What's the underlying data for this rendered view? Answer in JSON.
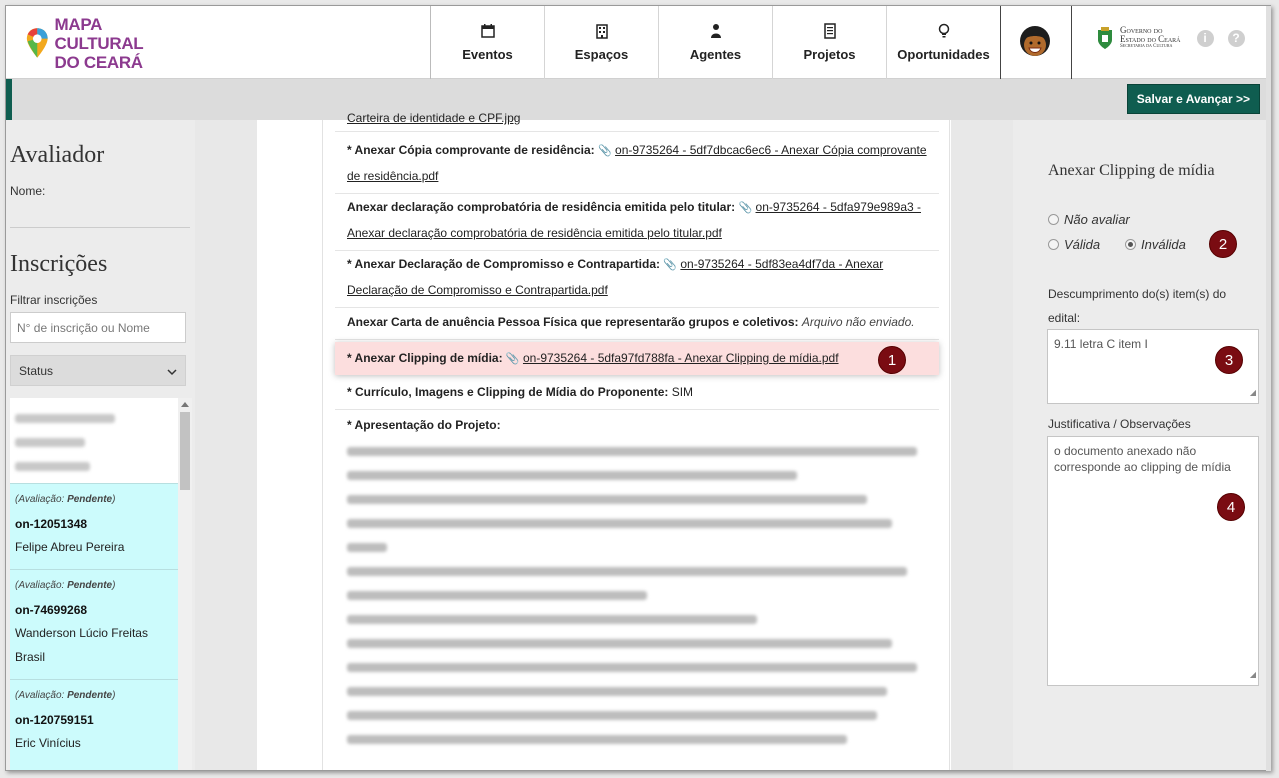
{
  "header": {
    "logo_line1": "MAPA CULTURAL",
    "logo_line2": "DO CEARÁ",
    "nav": [
      {
        "label": "Eventos",
        "icon": "calendar-icon",
        "glyph": "▭"
      },
      {
        "label": "Espaços",
        "icon": "building-icon",
        "glyph": "▥"
      },
      {
        "label": "Agentes",
        "icon": "person-icon",
        "glyph": "●"
      },
      {
        "label": "Projetos",
        "icon": "document-icon",
        "glyph": "▤"
      },
      {
        "label": "Oportunidades",
        "icon": "lightbulb-icon",
        "glyph": "♀"
      }
    ],
    "gov_line1": "Governo do",
    "gov_line2": "Estado do Ceará",
    "gov_line3": "Secretaria da Cultura",
    "info_glyph": "i",
    "help_glyph": "?"
  },
  "toolbar": {
    "save_label": "Salvar e Avançar >>"
  },
  "left": {
    "title": "Avaliador",
    "name_label": "Nome:",
    "inscricoes_title": "Inscrições",
    "filter_label": "Filtrar inscrições",
    "filter_placeholder": "N° de inscrição ou Nome",
    "status_label": "Status",
    "cards": [
      {
        "eval_prefix": "(Avaliação: ",
        "eval_status": "Pendente",
        "eval_suffix": ")",
        "number": "on-12051348",
        "name": "Felipe Abreu Pereira"
      },
      {
        "eval_prefix": "(Avaliação: ",
        "eval_status": "Pendente",
        "eval_suffix": ")",
        "number": "on-74699268",
        "name": "Wanderson Lúcio Freitas Brasil"
      },
      {
        "eval_prefix": "(Avaliação: ",
        "eval_status": "Pendente",
        "eval_suffix": ")",
        "number": "on-120759151",
        "name": "Eric Vinícius"
      }
    ]
  },
  "doc": {
    "top_cut": "Carteira de identidade e CPF.jpg",
    "f1_label": "* Anexar Cópia comprovante de residência:",
    "f1_link": "on-9735264 - 5df7dbcac6ec6 - Anexar Cópia comprovante de residência.pdf",
    "f2_label": "Anexar declaração comprobatória de residência emitida pelo titular:",
    "f2_link": "on-9735264 - 5dfa979e989a3 - Anexar declaração comprobatória de residência emitida pelo titular.pdf",
    "f3_label": "* Anexar Declaração de Compromisso e Contrapartida:",
    "f3_link": "on-9735264 - 5df83ea4df7da - Anexar Declaração de Compromisso e Contrapartida.pdf",
    "f4_label": "Anexar Carta de anuência Pessoa Física que representarão grupos e coletivos:",
    "f4_value": "Arquivo não enviado.",
    "f5_label": "* Anexar Clipping de mídia:",
    "f5_link": "on-9735264 - 5dfa97fd788fa - Anexar Clipping de mídia.pdf",
    "f6_label": "* Currículo, Imagens e Clipping de Mídia do Proponente:",
    "f6_value": "SIM",
    "f7_label": "* Apresentação do Projeto:"
  },
  "right": {
    "title": "Anexar Clipping de mídia",
    "opt_none": "Não avaliar",
    "opt_valid": "Válida",
    "opt_invalid": "Inválida",
    "selected": "Inválida",
    "desc_label": "Descumprimento do(s) item(s) do edital:",
    "desc_value": "9.11 letra C item I",
    "just_label": "Justificativa / Observações",
    "just_value": "o documento anexado não corresponde ao clipping de mídia"
  },
  "badges": [
    "1",
    "2",
    "3",
    "4"
  ],
  "colors": {
    "brand": "#8c3a8f",
    "save": "#0f5d50",
    "badge": "#7a0c12",
    "highlight": "#fcdede",
    "card": "#ccfbfc"
  }
}
